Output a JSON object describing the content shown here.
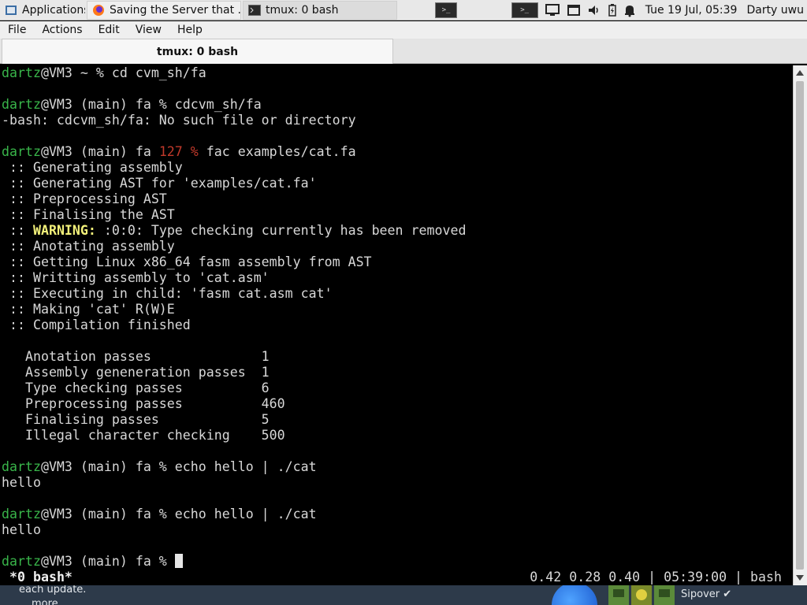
{
  "taskbar": {
    "apps_label": "Applications",
    "windows": [
      {
        "title": "Saving the Server that ...",
        "icon": "firefox-icon"
      },
      {
        "title": "tmux: 0 bash",
        "icon": "terminal-icon"
      }
    ],
    "clock": "Tue 19 Jul, 05:39",
    "user": "Darty uwu"
  },
  "menu": {
    "file": "File",
    "actions": "Actions",
    "edit": "Edit",
    "view": "View",
    "help": "Help"
  },
  "tab": {
    "title": "tmux: 0 bash"
  },
  "colors": {
    "prompt_user": "#39b54a",
    "error_code": "#c0392b",
    "warning": "#f3f17a"
  },
  "terminal": {
    "l1": {
      "user": "dartz",
      "rest": "@VM3 ~ % cd cvm_sh/fa"
    },
    "l3": {
      "user": "dartz",
      "rest": "@VM3 (main) fa % cdcvm_sh/fa"
    },
    "l4": "-bash: cdcvm_sh/fa: No such file or directory",
    "l6": {
      "user": "dartz",
      "rest1": "@VM3 (main) fa ",
      "code": "127 %",
      "rest2": " fac examples/cat.fa"
    },
    "l7": " :: Generating assembly",
    "l8": " :: Generating AST for 'examples/cat.fa'",
    "l9": " :: Preprocessing AST",
    "l10": " :: Finalising the AST",
    "l11": {
      "prefix": " :: ",
      "warn": "WARNING:",
      "rest": " :0:0: Type checking currently has been removed"
    },
    "l12": " :: Anotating assembly",
    "l13": " :: Getting Linux x86_64 fasm assembly from AST",
    "l14": " :: Writting assembly to 'cat.asm'",
    "l15": " :: Executing in child: 'fasm cat.asm cat'",
    "l16": " :: Making 'cat' R(W)E",
    "l17": " :: Compilation finished",
    "l19": "   Anotation passes              1",
    "l20": "   Assembly geneneration passes  1",
    "l21": "   Type checking passes          6",
    "l22": "   Preprocessing passes          460",
    "l23": "   Finalising passes             5",
    "l24": "   Illegal character checking    500",
    "l26": {
      "user": "dartz",
      "rest": "@VM3 (main) fa % echo hello | ./cat"
    },
    "l27": "hello",
    "l29": {
      "user": "dartz",
      "rest": "@VM3 (main) fa % echo hello | ./cat"
    },
    "l30": "hello",
    "l32": {
      "user": "dartz",
      "rest": "@VM3 (main) fa % "
    }
  },
  "status": {
    "left": " *0 bash*",
    "right": "0.42 0.28 0.40 | 05:39:00 | bash"
  },
  "bottom": {
    "text": "each update.",
    "more": "more",
    "sipover": "Sipover"
  }
}
